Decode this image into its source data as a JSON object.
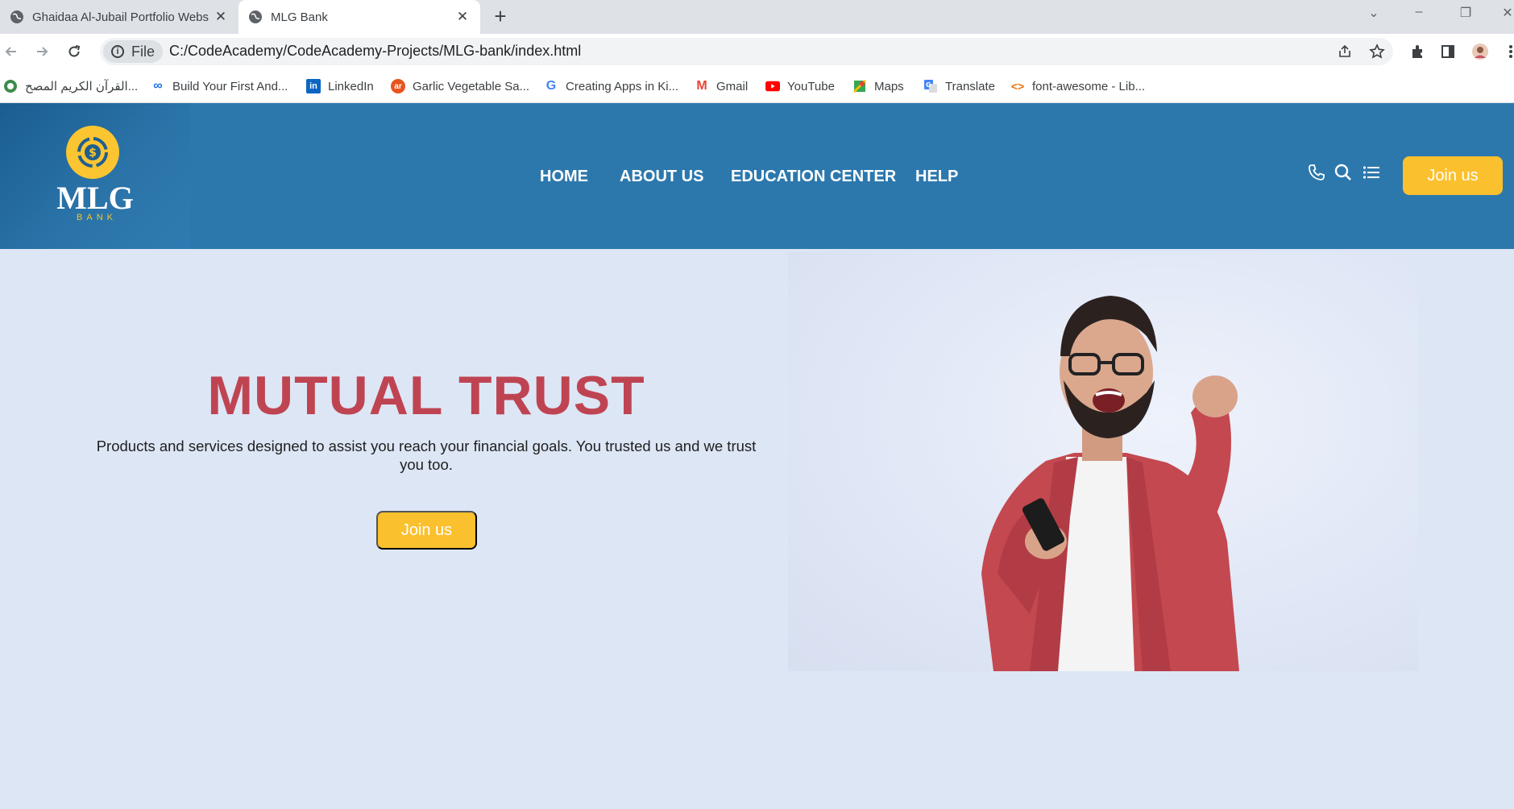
{
  "browser": {
    "tabs": [
      {
        "title": "Ghaidaa Al-Jubail Portfolio Webs"
      },
      {
        "title": "MLG Bank"
      }
    ],
    "omnibox": {
      "chip_label": "File",
      "url": "C:/CodeAcademy/CodeAcademy-Projects/MLG-bank/index.html"
    },
    "bookmarks": [
      {
        "label": "القرآن الكريم المصح...",
        "icon": "quran-icon"
      },
      {
        "label": "Build Your First And...",
        "icon": "infinity-icon"
      },
      {
        "label": "LinkedIn",
        "icon": "linkedin-icon"
      },
      {
        "label": "Garlic Vegetable Sa...",
        "icon": "ar-icon"
      },
      {
        "label": "Creating Apps in Ki...",
        "icon": "google-icon"
      },
      {
        "label": "Gmail",
        "icon": "gmail-icon"
      },
      {
        "label": "YouTube",
        "icon": "youtube-icon"
      },
      {
        "label": "Maps",
        "icon": "maps-icon"
      },
      {
        "label": "Translate",
        "icon": "translate-icon"
      },
      {
        "label": "font-awesome - Lib...",
        "icon": "code-icon"
      }
    ]
  },
  "site": {
    "logo": {
      "name": "MLG",
      "sub": "BANK"
    },
    "nav": [
      "HOME",
      "ABOUT US",
      "EDUCATION CENTER",
      "HELP"
    ],
    "header_button": "Join us",
    "hero": {
      "title": "MUTUAL TRUST",
      "text": "Products and services designed to assist you reach your financial goals. You trusted us and we trust you too.",
      "button": "Join us"
    },
    "colors": {
      "header_bg": "#2c78ad",
      "accent_yellow": "#fbc02d",
      "title_red": "#bf4452",
      "page_bg": "#dde6f5"
    }
  }
}
